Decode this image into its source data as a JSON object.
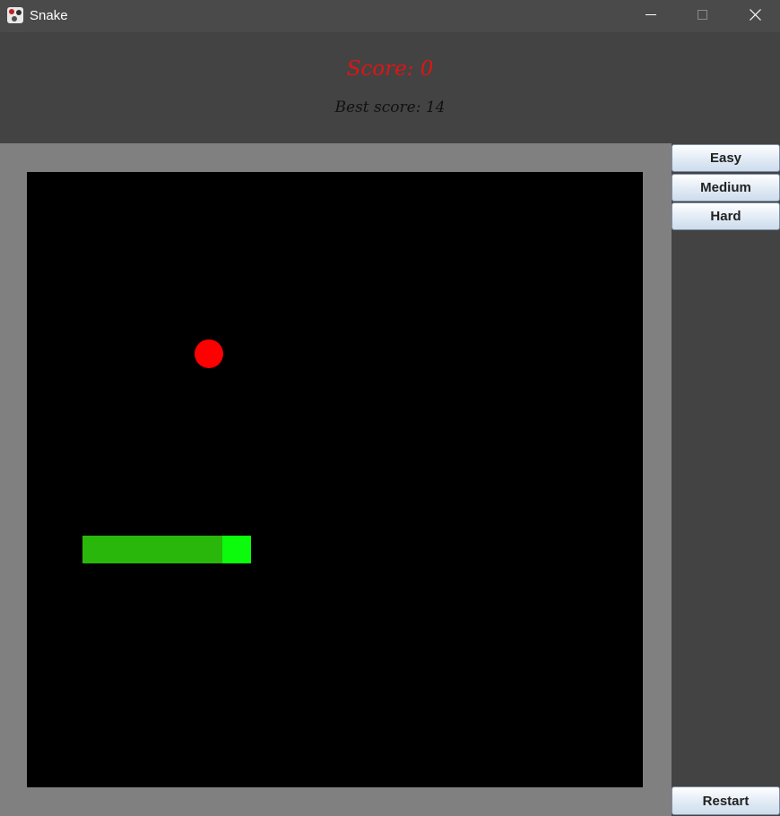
{
  "window": {
    "title": "Snake"
  },
  "header": {
    "score": "Score: 0",
    "best_score": "Best score: 14"
  },
  "controls": {
    "difficulties": [
      "Easy",
      "Medium",
      "Hard"
    ],
    "restart_label": "Restart"
  },
  "game": {
    "snake_length": 7,
    "colors": {
      "board": "#000000",
      "border": "#808080",
      "food": "#ff0000",
      "snake_body": "#2ab70b",
      "snake_head": "#0cfa0c",
      "score": "#e01414"
    }
  },
  "icons": {
    "app": "snake-app-icon",
    "minimize": "minimize-icon",
    "maximize": "maximize-icon",
    "close": "close-icon"
  }
}
